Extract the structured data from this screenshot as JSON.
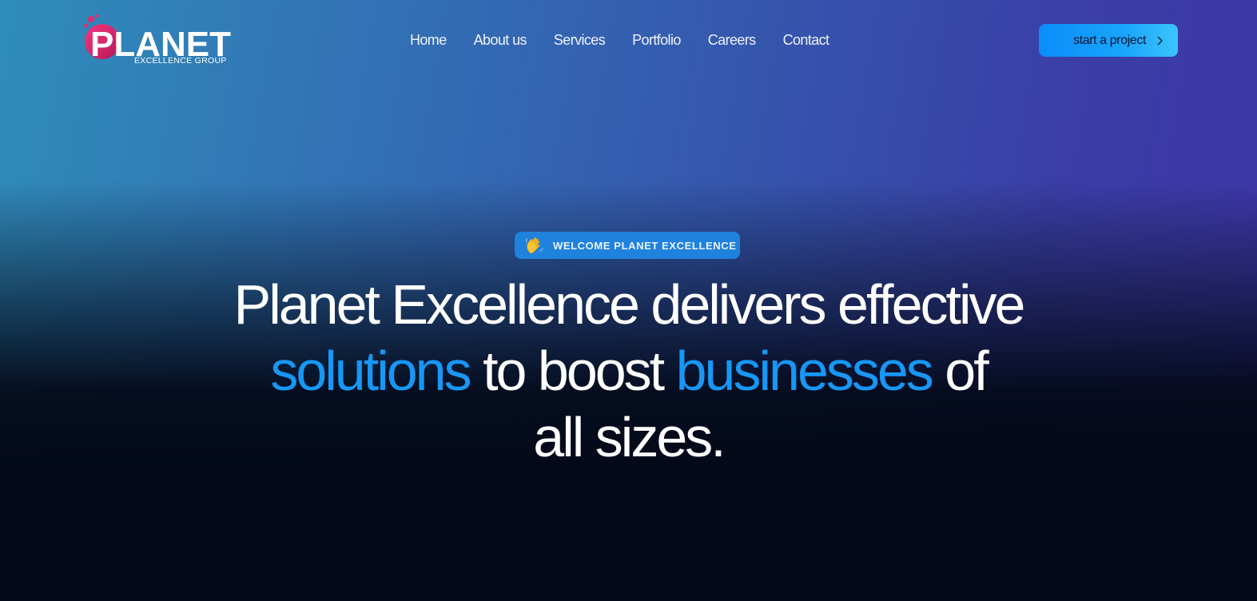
{
  "brand": {
    "logo_wordmark": "PLANET",
    "logo_tagline": "EXCELLENCE GROUP",
    "colors": {
      "logo_pink": "#d6246a",
      "accent_blue": "#1797f6",
      "cta_blue": "#0b8dfb",
      "background_dark": "#030918"
    }
  },
  "nav": {
    "items": [
      {
        "label": "Home"
      },
      {
        "label": "About us"
      },
      {
        "label": "Services"
      },
      {
        "label": "Portfolio"
      },
      {
        "label": "Careers"
      },
      {
        "label": "Contact"
      }
    ]
  },
  "cta": {
    "label": "start a project",
    "icon": "chevron-right-icon"
  },
  "badge": {
    "icon": "waving-hand-icon",
    "text": "WELCOME PLANET EXCELLENCE"
  },
  "hero": {
    "line1": "Planet Excellence delivers effective",
    "word_solutions": "solutions",
    "word_to_boost": "to boost",
    "word_businesses": "businesses",
    "word_of": "of",
    "line3": "all sizes."
  }
}
